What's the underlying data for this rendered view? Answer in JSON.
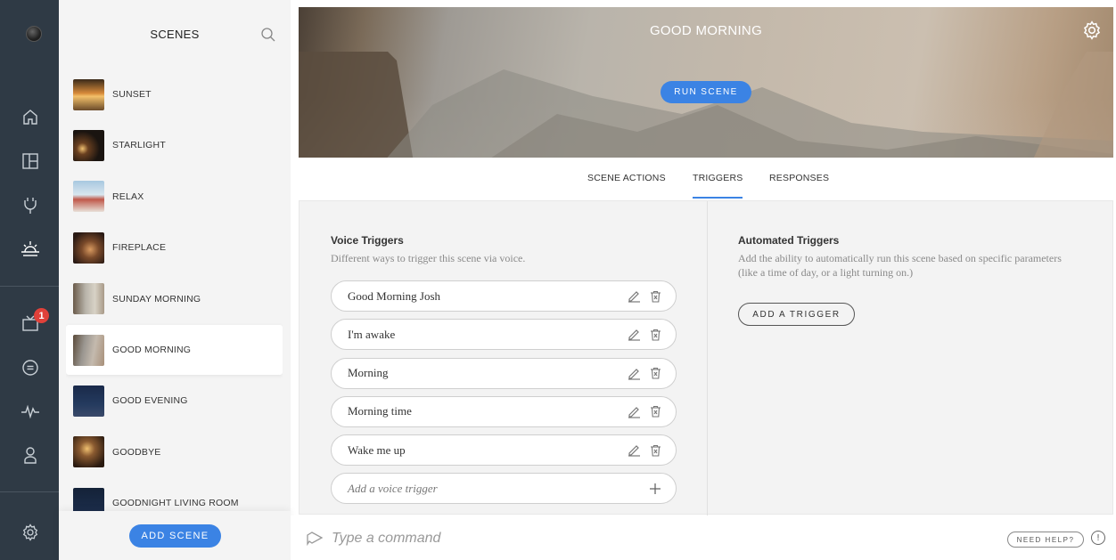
{
  "rail": {
    "items": [
      {
        "icon": "logo-icon"
      },
      {
        "icon": "home-icon"
      },
      {
        "icon": "layout-icon"
      },
      {
        "icon": "plug-icon"
      },
      {
        "icon": "sunrise-icon"
      },
      {
        "icon": "inbox-icon"
      },
      {
        "icon": "chat-icon"
      },
      {
        "icon": "pulse-icon"
      },
      {
        "icon": "person-icon"
      },
      {
        "icon": "gear-icon"
      }
    ],
    "badge_count": "1"
  },
  "scenes": {
    "title": "SCENES",
    "items": [
      {
        "label": "SUNSET",
        "thumb": "linear-gradient(180deg,#3a2a1a 0%,#d68a3a 45%,#f3c06a 55%,#6a4a2a 100%)"
      },
      {
        "label": "STARLIGHT",
        "thumb": "radial-gradient(circle at 30% 60%,#f0c070 0%,#6a4020 20%,#1a1410 60%)"
      },
      {
        "label": "RELAX",
        "thumb": "linear-gradient(180deg,#a8c8e0 0%,#d8e6ee 45%,#c0584a 60%,#e8e0d8 100%)"
      },
      {
        "label": "FIREPLACE",
        "thumb": "radial-gradient(circle at 55% 55%,#d89a60 0%,#7a4a2a 35%,#2a1a14 80%)"
      },
      {
        "label": "SUNDAY MORNING",
        "thumb": "linear-gradient(90deg,#6a5a4a 0%,#b8b4aa 40%,#d8d2c6 70%,#a89a88 100%)"
      },
      {
        "label": "GOOD MORNING",
        "thumb": "linear-gradient(100deg,#5a4a3a 0%,#9a9690 35%,#c4baae 65%,#a8907a 100%)"
      },
      {
        "label": "GOOD EVENING",
        "thumb": "linear-gradient(180deg,#1a2a4a 0%,#243a5e 60%,#3a4a6a 100%)"
      },
      {
        "label": "GOODBYE",
        "thumb": "radial-gradient(circle at 45% 40%,#f0c070 0%,#8a5a30 30%,#2a1a10 80%)"
      },
      {
        "label": "GOODNIGHT LIVING ROOM",
        "thumb": "linear-gradient(180deg,#142238 0%,#1e3050 100%)"
      }
    ],
    "active_index": 5,
    "add_label": "ADD SCENE"
  },
  "hero": {
    "title": "GOOD MORNING",
    "run_label": "RUN SCENE"
  },
  "tabs": [
    {
      "label": "SCENE ACTIONS"
    },
    {
      "label": "TRIGGERS"
    },
    {
      "label": "RESPONSES"
    }
  ],
  "voice": {
    "title": "Voice Triggers",
    "desc": "Different ways to trigger this scene via voice.",
    "triggers": [
      "Good Morning Josh",
      "I'm awake",
      "Morning",
      "Morning time",
      "Wake me up"
    ],
    "add_placeholder": "Add a voice trigger"
  },
  "automated": {
    "title": "Automated Triggers",
    "desc": "Add the ability to automatically run this scene based on specific parameters (like a time of day, or a light turning on.)",
    "add_label": "ADD A TRIGGER"
  },
  "command": {
    "placeholder": "Type a command",
    "help_label": "NEED HELP?",
    "info_glyph": "!"
  },
  "colors": {
    "accent": "#3b83e4",
    "rail": "#2f3a45",
    "badge": "#e0413a"
  }
}
